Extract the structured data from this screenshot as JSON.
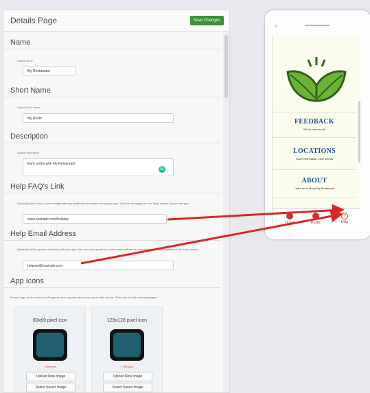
{
  "panel": {
    "title": "Details Page",
    "save_label": "Save Changes",
    "sections": {
      "name": {
        "heading": "Name",
        "label": "Adjust Name",
        "value": "My Restaurant"
      },
      "short_name": {
        "heading": "Short Name",
        "label": "Adjust Short Name",
        "value": "My Resto"
      },
      "description": {
        "heading": "Description",
        "label": "Adjust Description",
        "value": "Earn points with My Restaurant"
      },
      "help_faq": {
        "heading": "Help FAQ's Link",
        "help": "(Optional) Add a link to your website with any additional information about your app. This link will appear on the 'Help' screen of your web app.",
        "value": "www.example.com/helpfaq"
      },
      "help_email": {
        "heading": "Help Email Address",
        "help": "(Optional) When guests need help with your app, they can send questions to this email address for your restaurant. This appears on the 'Help' screen.",
        "value": "helpme@example.com"
      },
      "app_icons": {
        "heading": "App Icons",
        "help": "Set your logo as the icon that will appear when a guest saves your app to their device.",
        "help_link": "Click here for help resizing images.",
        "cards": [
          {
            "title": "80x80 pixel icon",
            "remove": "× Remove",
            "upload": "Upload New Image",
            "select": "Select Saved Image"
          },
          {
            "title": "128x128 pixel icon",
            "remove": "× Remove",
            "upload": "Upload New Image",
            "select": "Select Saved Image"
          }
        ]
      }
    }
  },
  "phone": {
    "menu": [
      {
        "title": "FEEDBACK",
        "sub": "Tell us how we did"
      },
      {
        "title": "LOCATIONS",
        "sub": "Store information, view menus"
      },
      {
        "title": "ABOUT",
        "sub": "Learn more about My Restaurant"
      }
    ],
    "tabs": [
      {
        "label": "Home"
      },
      {
        "label": "Profile"
      },
      {
        "label": "Help",
        "glyph": "?"
      }
    ]
  },
  "colors": {
    "accent_green": "#3f8e3a",
    "menu_blue": "#1f4f8f",
    "arrow_red": "#e02424",
    "leaf_green": "#5aa832"
  }
}
